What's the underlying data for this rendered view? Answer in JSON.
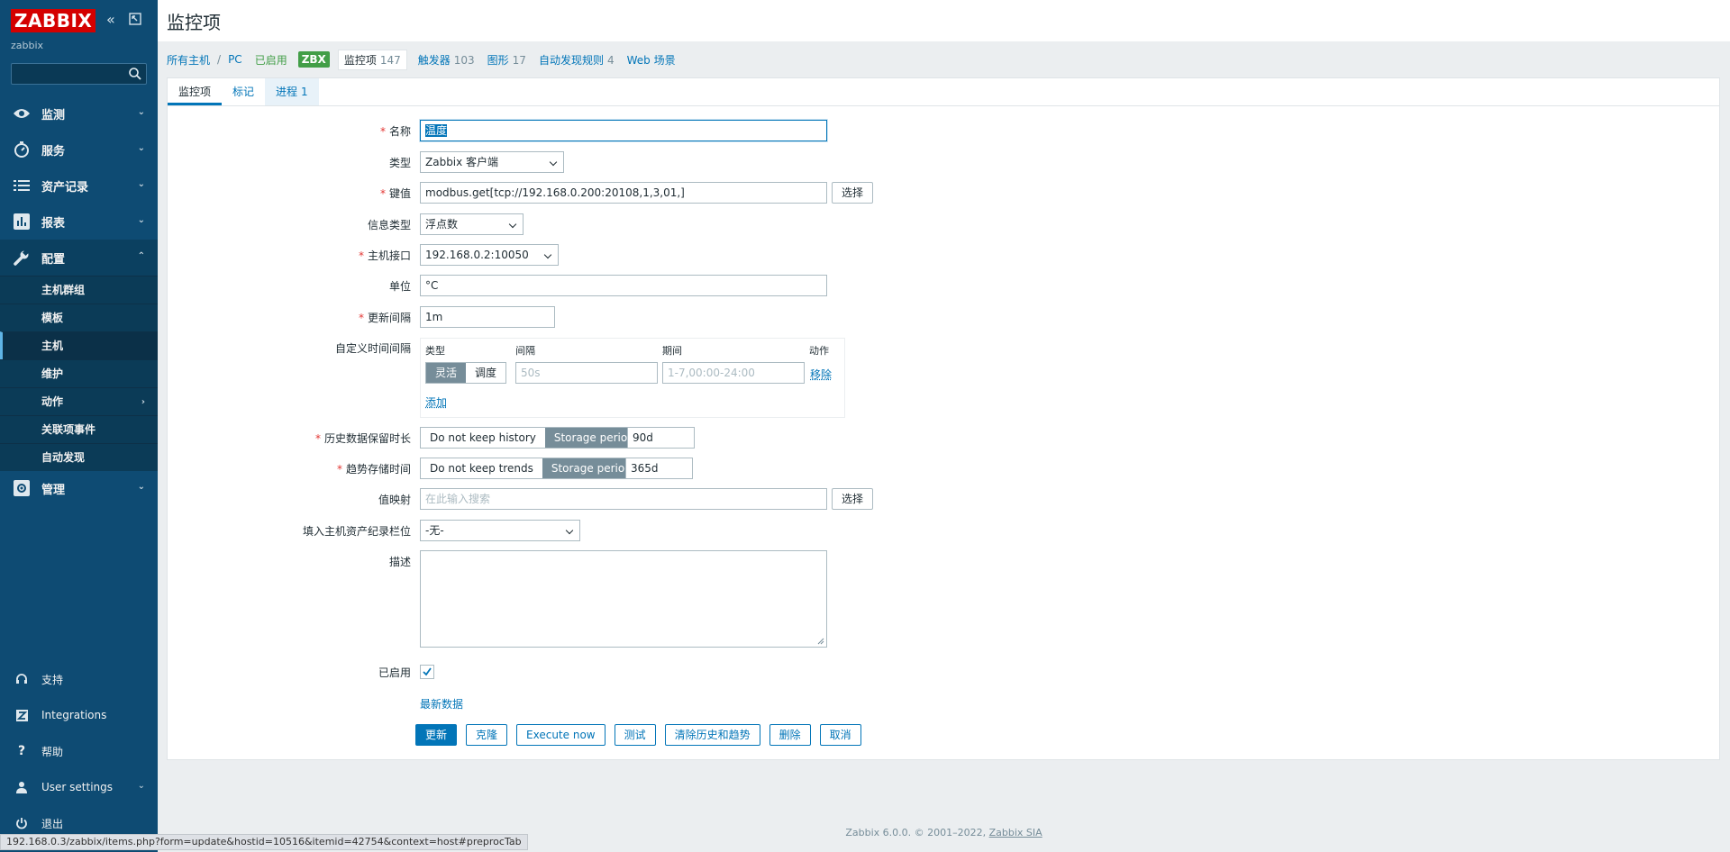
{
  "sidebar": {
    "logo": "ZABBIX",
    "server_name": "zabbix",
    "menu": [
      {
        "label": "监测",
        "icon": "eye-icon"
      },
      {
        "label": "服务",
        "icon": "clock-icon"
      },
      {
        "label": "资产记录",
        "icon": "list-icon"
      },
      {
        "label": "报表",
        "icon": "bar-chart-icon"
      },
      {
        "label": "配置",
        "icon": "wrench-icon"
      }
    ],
    "submenu": [
      {
        "label": "主机群组"
      },
      {
        "label": "模板"
      },
      {
        "label": "主机"
      },
      {
        "label": "维护"
      },
      {
        "label": "动作"
      },
      {
        "label": "关联项事件"
      },
      {
        "label": "自动发现"
      }
    ],
    "admin": {
      "label": "管理",
      "icon": "gear-icon"
    },
    "bottom": [
      {
        "label": "支持",
        "icon": "headset-icon"
      },
      {
        "label": "Integrations",
        "icon": "z-icon"
      },
      {
        "label": "帮助",
        "icon": "question-icon"
      },
      {
        "label": "User settings",
        "icon": "user-icon"
      },
      {
        "label": "退出",
        "icon": "power-icon"
      }
    ]
  },
  "header": {
    "title": "监控项"
  },
  "hostnav": {
    "all_hosts": "所有主机",
    "separator": "/",
    "host": "PC",
    "enabled": "已启用",
    "zbx": "ZBX",
    "tabs": [
      {
        "label": "监控项",
        "count": "147"
      },
      {
        "label": "触发器",
        "count": "103"
      },
      {
        "label": "图形",
        "count": "17"
      },
      {
        "label": "自动发现规则",
        "count": "4"
      },
      {
        "label": "Web 场景",
        "count": ""
      }
    ]
  },
  "form_tabs": [
    {
      "label": "监控项",
      "count": ""
    },
    {
      "label": "标记",
      "count": ""
    },
    {
      "label": "进程",
      "count": "1"
    }
  ],
  "form": {
    "name": {
      "label": "名称",
      "value": "温度"
    },
    "type": {
      "label": "类型",
      "value": "Zabbix 客户端"
    },
    "key": {
      "label": "键值",
      "value": "modbus.get[tcp://192.168.0.200:20108,1,3,01,]",
      "select": "选择"
    },
    "info_type": {
      "label": "信息类型",
      "value": "浮点数"
    },
    "interface": {
      "label": "主机接口",
      "value": "192.168.0.2:10050"
    },
    "units": {
      "label": "单位",
      "value": "°C"
    },
    "update_interval": {
      "label": "更新间隔",
      "value": "1m"
    },
    "custom_intervals": {
      "label": "自定义时间间隔",
      "headers": {
        "type": "类型",
        "interval": "间隔",
        "period": "期间",
        "action": "动作"
      },
      "seg_flex": "灵活",
      "seg_sched": "调度",
      "interval_placeholder": "50s",
      "period_placeholder": "1-7,00:00-24:00",
      "remove": "移除",
      "add": "添加"
    },
    "history": {
      "label": "历史数据保留时长",
      "opt1": "Do not keep history",
      "opt2": "Storage period",
      "value": "90d"
    },
    "trends": {
      "label": "趋势存储时间",
      "opt1": "Do not keep trends",
      "opt2": "Storage period",
      "value": "365d"
    },
    "valuemap": {
      "label": "值映射",
      "placeholder": "在此输入搜索",
      "select": "选择"
    },
    "inventory": {
      "label": "填入主机资产纪录栏位",
      "value": "-无-"
    },
    "description": {
      "label": "描述"
    },
    "enabled": {
      "label": "已启用"
    },
    "latest_data": "最新数据",
    "buttons": {
      "update": "更新",
      "clone": "克隆",
      "execute": "Execute now",
      "test": "测试",
      "clear": "清除历史和趋势",
      "delete": "删除",
      "cancel": "取消"
    }
  },
  "footer": {
    "text": "Zabbix 6.0.0. © 2001–2022,",
    "link": "Zabbix SIA"
  },
  "statusbar": {
    "url": "192.168.0.3/zabbix/items.php?form=update&hostid=10516&itemid=42754&context=host#preprocTab"
  }
}
